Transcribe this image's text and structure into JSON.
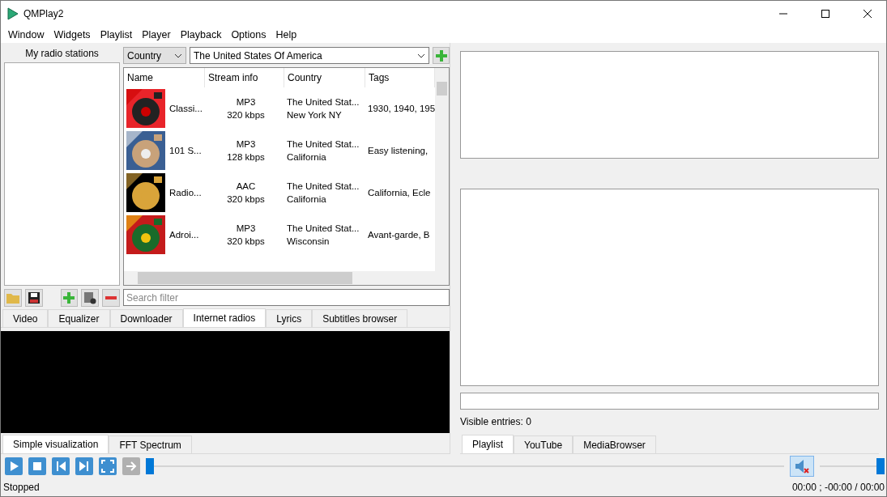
{
  "window": {
    "title": "QMPlay2"
  },
  "menu": [
    "Window",
    "Widgets",
    "Playlist",
    "Player",
    "Playback",
    "Options",
    "Help"
  ],
  "radio_panel": {
    "title": "My radio stations"
  },
  "filter": {
    "by": "Country",
    "value": "The United States Of America"
  },
  "table": {
    "columns": [
      "Name",
      "Stream info",
      "Country",
      "Tags"
    ],
    "rows": [
      {
        "name": "Classi...",
        "format": "MP3",
        "bitrate": "320 kbps",
        "country": "The United Stat...",
        "region": "New York NY",
        "tags": "1930, 1940, 195"
      },
      {
        "name": "101 S...",
        "format": "MP3",
        "bitrate": "128 kbps",
        "country": "The United Stat...",
        "region": "California",
        "tags": "Easy listening,"
      },
      {
        "name": "Radio...",
        "format": "AAC",
        "bitrate": "320 kbps",
        "country": "The United Stat...",
        "region": "California",
        "tags": "California, Ecle"
      },
      {
        "name": "Adroi...",
        "format": "MP3",
        "bitrate": "320 kbps",
        "country": "The United Stat...",
        "region": "Wisconsin",
        "tags": "Avant-garde, B"
      }
    ]
  },
  "search": {
    "placeholder": "Search filter"
  },
  "dock_tabs": [
    {
      "label": "Video",
      "selected": false
    },
    {
      "label": "Equalizer",
      "selected": false
    },
    {
      "label": "Downloader",
      "selected": false
    },
    {
      "label": "Internet radios",
      "selected": true
    },
    {
      "label": "Lyrics",
      "selected": false
    },
    {
      "label": "Subtitles browser",
      "selected": false
    }
  ],
  "vis_tabs": [
    {
      "label": "Simple visualization",
      "selected": true
    },
    {
      "label": "FFT Spectrum",
      "selected": false
    }
  ],
  "playlist": {
    "visible_entries": "Visible entries: 0"
  },
  "playlist_tabs": [
    {
      "label": "Playlist",
      "selected": true
    },
    {
      "label": "YouTube",
      "selected": false
    },
    {
      "label": "MediaBrowser",
      "selected": false
    }
  ],
  "seek": {
    "level": 0
  },
  "volume": {
    "level": 1,
    "muted": true
  },
  "status": {
    "state": "Stopped",
    "time": "00:00 ; -00:00 / 00:00"
  }
}
